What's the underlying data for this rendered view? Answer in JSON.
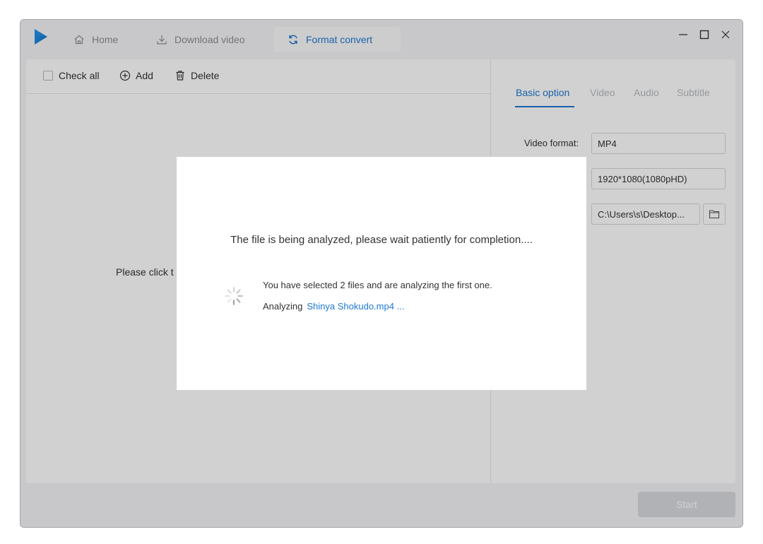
{
  "app": {
    "tabs": [
      {
        "label": "Home",
        "icon": "home-icon"
      },
      {
        "label": "Download video",
        "icon": "download-icon"
      },
      {
        "label": "Format convert",
        "icon": "refresh-icon",
        "active": true
      }
    ],
    "accent_color": "#1f78d1"
  },
  "toolbar": {
    "check_all_label": "Check all",
    "add_label": "Add",
    "delete_label": "Delete"
  },
  "file_list": {
    "empty_hint": "Please click t"
  },
  "options": {
    "tabs": [
      "Basic option",
      "Video",
      "Audio",
      "Subtitle"
    ],
    "active_tab": "Basic option",
    "video_format_label": "Video format:",
    "video_format_value": "MP4",
    "resolution_value": "1920*1080(1080pHD)",
    "output_path_value": "C:\\Users\\s\\Desktop..."
  },
  "start_label": "Start",
  "dialog": {
    "title": "The file is being analyzed, please wait patiently for completion....",
    "selected_text": "You have selected 2 files and are analyzing the first one.",
    "analyzing_label": "Analyzing",
    "current_file": "Shinya Shokudo.mp4 ..."
  }
}
